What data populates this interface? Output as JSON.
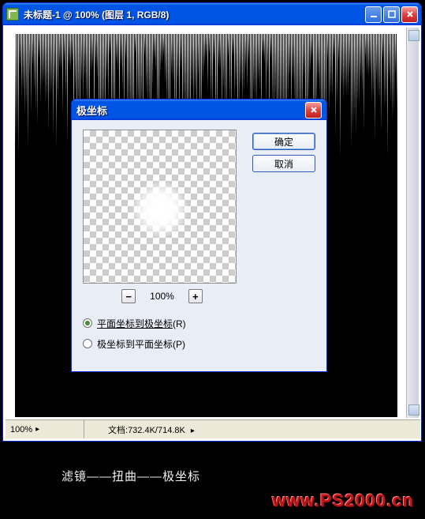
{
  "window": {
    "title": "未标题-1 @ 100% (图层 1, RGB/8)"
  },
  "statusbar": {
    "zoom": "100%",
    "doc_label": "文档:",
    "doc_size": "732.4K/714.8K"
  },
  "dialog": {
    "title": "极坐标",
    "ok_label": "确定",
    "cancel_label": "取消",
    "zoom_value": "100%",
    "minus": "−",
    "plus": "+",
    "radio1_label": "平面坐标到极坐标",
    "radio1_key": "(R)",
    "radio2_label": "极坐标到平面坐标",
    "radio2_key": "(P)"
  },
  "caption": "滤镜——扭曲——极坐标",
  "watermark": "www.PS2000.cn"
}
